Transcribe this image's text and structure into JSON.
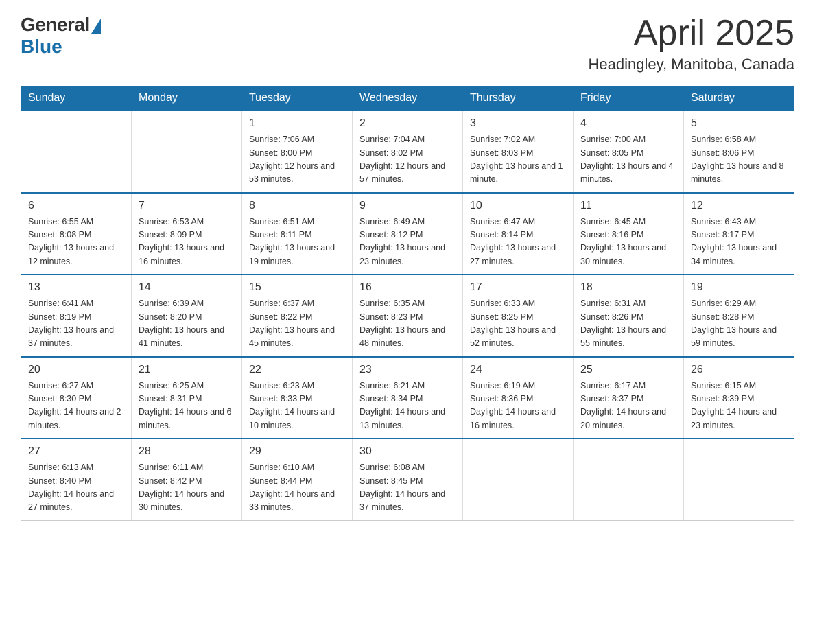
{
  "header": {
    "logo_general": "General",
    "logo_blue": "Blue",
    "title": "April 2025",
    "location": "Headingley, Manitoba, Canada"
  },
  "calendar": {
    "days_of_week": [
      "Sunday",
      "Monday",
      "Tuesday",
      "Wednesday",
      "Thursday",
      "Friday",
      "Saturday"
    ],
    "weeks": [
      [
        {
          "day": "",
          "info": ""
        },
        {
          "day": "",
          "info": ""
        },
        {
          "day": "1",
          "info": "Sunrise: 7:06 AM\nSunset: 8:00 PM\nDaylight: 12 hours\nand 53 minutes."
        },
        {
          "day": "2",
          "info": "Sunrise: 7:04 AM\nSunset: 8:02 PM\nDaylight: 12 hours\nand 57 minutes."
        },
        {
          "day": "3",
          "info": "Sunrise: 7:02 AM\nSunset: 8:03 PM\nDaylight: 13 hours\nand 1 minute."
        },
        {
          "day": "4",
          "info": "Sunrise: 7:00 AM\nSunset: 8:05 PM\nDaylight: 13 hours\nand 4 minutes."
        },
        {
          "day": "5",
          "info": "Sunrise: 6:58 AM\nSunset: 8:06 PM\nDaylight: 13 hours\nand 8 minutes."
        }
      ],
      [
        {
          "day": "6",
          "info": "Sunrise: 6:55 AM\nSunset: 8:08 PM\nDaylight: 13 hours\nand 12 minutes."
        },
        {
          "day": "7",
          "info": "Sunrise: 6:53 AM\nSunset: 8:09 PM\nDaylight: 13 hours\nand 16 minutes."
        },
        {
          "day": "8",
          "info": "Sunrise: 6:51 AM\nSunset: 8:11 PM\nDaylight: 13 hours\nand 19 minutes."
        },
        {
          "day": "9",
          "info": "Sunrise: 6:49 AM\nSunset: 8:12 PM\nDaylight: 13 hours\nand 23 minutes."
        },
        {
          "day": "10",
          "info": "Sunrise: 6:47 AM\nSunset: 8:14 PM\nDaylight: 13 hours\nand 27 minutes."
        },
        {
          "day": "11",
          "info": "Sunrise: 6:45 AM\nSunset: 8:16 PM\nDaylight: 13 hours\nand 30 minutes."
        },
        {
          "day": "12",
          "info": "Sunrise: 6:43 AM\nSunset: 8:17 PM\nDaylight: 13 hours\nand 34 minutes."
        }
      ],
      [
        {
          "day": "13",
          "info": "Sunrise: 6:41 AM\nSunset: 8:19 PM\nDaylight: 13 hours\nand 37 minutes."
        },
        {
          "day": "14",
          "info": "Sunrise: 6:39 AM\nSunset: 8:20 PM\nDaylight: 13 hours\nand 41 minutes."
        },
        {
          "day": "15",
          "info": "Sunrise: 6:37 AM\nSunset: 8:22 PM\nDaylight: 13 hours\nand 45 minutes."
        },
        {
          "day": "16",
          "info": "Sunrise: 6:35 AM\nSunset: 8:23 PM\nDaylight: 13 hours\nand 48 minutes."
        },
        {
          "day": "17",
          "info": "Sunrise: 6:33 AM\nSunset: 8:25 PM\nDaylight: 13 hours\nand 52 minutes."
        },
        {
          "day": "18",
          "info": "Sunrise: 6:31 AM\nSunset: 8:26 PM\nDaylight: 13 hours\nand 55 minutes."
        },
        {
          "day": "19",
          "info": "Sunrise: 6:29 AM\nSunset: 8:28 PM\nDaylight: 13 hours\nand 59 minutes."
        }
      ],
      [
        {
          "day": "20",
          "info": "Sunrise: 6:27 AM\nSunset: 8:30 PM\nDaylight: 14 hours\nand 2 minutes."
        },
        {
          "day": "21",
          "info": "Sunrise: 6:25 AM\nSunset: 8:31 PM\nDaylight: 14 hours\nand 6 minutes."
        },
        {
          "day": "22",
          "info": "Sunrise: 6:23 AM\nSunset: 8:33 PM\nDaylight: 14 hours\nand 10 minutes."
        },
        {
          "day": "23",
          "info": "Sunrise: 6:21 AM\nSunset: 8:34 PM\nDaylight: 14 hours\nand 13 minutes."
        },
        {
          "day": "24",
          "info": "Sunrise: 6:19 AM\nSunset: 8:36 PM\nDaylight: 14 hours\nand 16 minutes."
        },
        {
          "day": "25",
          "info": "Sunrise: 6:17 AM\nSunset: 8:37 PM\nDaylight: 14 hours\nand 20 minutes."
        },
        {
          "day": "26",
          "info": "Sunrise: 6:15 AM\nSunset: 8:39 PM\nDaylight: 14 hours\nand 23 minutes."
        }
      ],
      [
        {
          "day": "27",
          "info": "Sunrise: 6:13 AM\nSunset: 8:40 PM\nDaylight: 14 hours\nand 27 minutes."
        },
        {
          "day": "28",
          "info": "Sunrise: 6:11 AM\nSunset: 8:42 PM\nDaylight: 14 hours\nand 30 minutes."
        },
        {
          "day": "29",
          "info": "Sunrise: 6:10 AM\nSunset: 8:44 PM\nDaylight: 14 hours\nand 33 minutes."
        },
        {
          "day": "30",
          "info": "Sunrise: 6:08 AM\nSunset: 8:45 PM\nDaylight: 14 hours\nand 37 minutes."
        },
        {
          "day": "",
          "info": ""
        },
        {
          "day": "",
          "info": ""
        },
        {
          "day": "",
          "info": ""
        }
      ]
    ]
  }
}
